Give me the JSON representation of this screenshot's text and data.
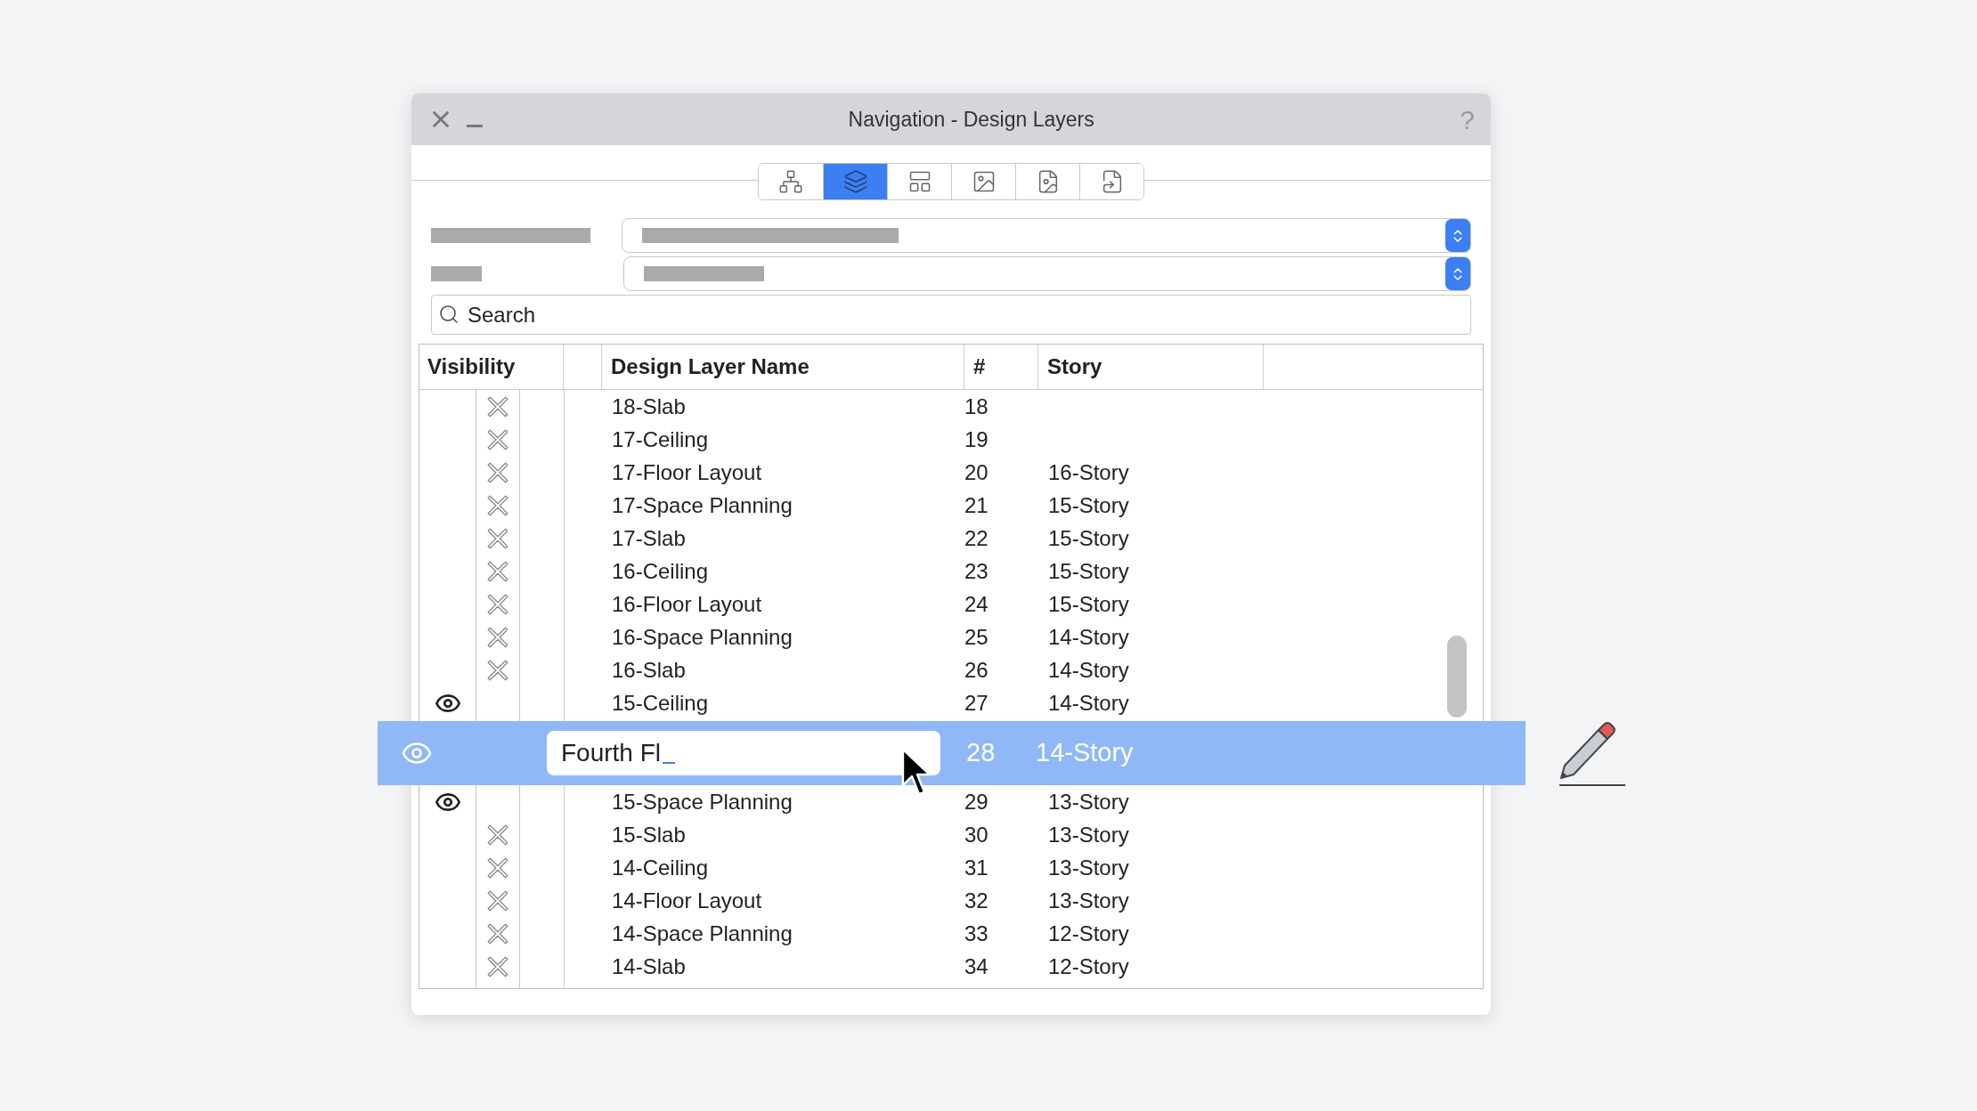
{
  "window": {
    "title": "Navigation - Design Layers",
    "help": "?"
  },
  "toolbar": [
    {
      "kind": "hierarchy",
      "selected": false
    },
    {
      "kind": "layers",
      "selected": true
    },
    {
      "kind": "layout",
      "selected": false
    },
    {
      "kind": "image",
      "selected": false
    },
    {
      "kind": "image-file",
      "selected": false
    },
    {
      "kind": "file-link",
      "selected": false
    }
  ],
  "search": {
    "placeholder": "Search"
  },
  "table": {
    "columns": [
      "Visibility",
      "Design Layer Name",
      "#",
      "Story"
    ],
    "rows": [
      {
        "visible": false,
        "name": "18-Slab",
        "number": "18"
      },
      {
        "visible": false,
        "name": "17-Ceiling",
        "number": "19"
      },
      {
        "visible": false,
        "name": "17-Floor Layout",
        "number": "20",
        "story": "16-Story"
      },
      {
        "visible": false,
        "name": "17-Space Planning",
        "number": "21",
        "story": "15-Story"
      },
      {
        "visible": false,
        "name": "17-Slab",
        "number": "22",
        "story": "15-Story"
      },
      {
        "visible": false,
        "name": "16-Ceiling",
        "number": "23",
        "story": "15-Story"
      },
      {
        "visible": false,
        "name": "16-Floor Layout",
        "number": "24",
        "story": "15-Story"
      },
      {
        "visible": false,
        "name": "16-Space Planning",
        "number": "25",
        "story": "14-Story"
      },
      {
        "visible": false,
        "name": "16-Slab",
        "number": "26",
        "story": "14-Story"
      },
      {
        "visible": true,
        "name": "15-Ceiling",
        "number": "27",
        "story": "14-Story"
      },
      {
        "visible": true,
        "name": "15-Space Planning",
        "number": "29",
        "story": "13-Story"
      },
      {
        "visible": false,
        "name": "15-Slab",
        "number": "30",
        "story": "13-Story"
      },
      {
        "visible": false,
        "name": "14-Ceiling",
        "number": "31",
        "story": "13-Story"
      },
      {
        "visible": false,
        "name": "14-Floor Layout",
        "number": "32",
        "story": "13-Story"
      },
      {
        "visible": false,
        "name": "14-Space Planning",
        "number": "33",
        "story": "12-Story"
      },
      {
        "visible": false,
        "name": "14-Slab",
        "number": "34",
        "story": "12-Story"
      }
    ]
  },
  "drag_row": {
    "visible": true,
    "name": "Fourth Fl",
    "number": "28",
    "story": "14-Story"
  }
}
